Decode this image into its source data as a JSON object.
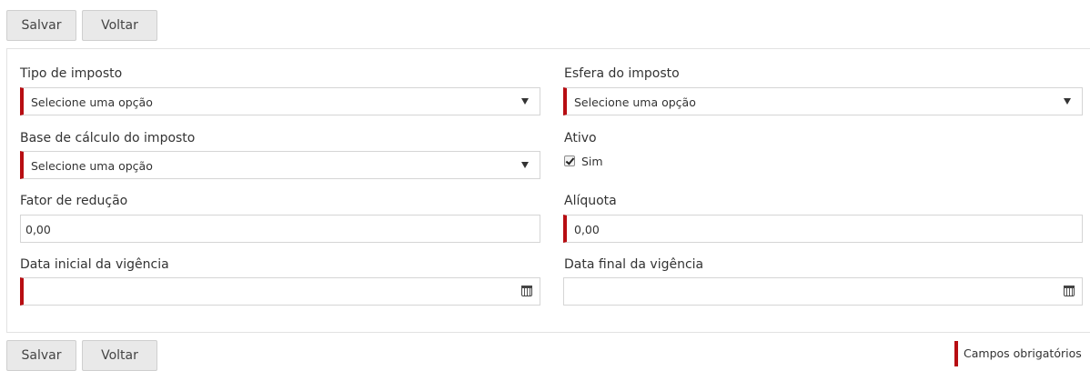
{
  "toolbar": {
    "save_label": "Salvar",
    "back_label": "Voltar"
  },
  "form": {
    "tipo_imposto": {
      "label": "Tipo de imposto",
      "value": "Selecione uma opção"
    },
    "esfera_imposto": {
      "label": "Esfera do imposto",
      "value": "Selecione uma opção"
    },
    "base_calculo": {
      "label": "Base de cálculo do imposto",
      "value": "Selecione uma opção"
    },
    "ativo": {
      "label": "Ativo",
      "option_label": "Sim",
      "checked": true
    },
    "fator_reducao": {
      "label": "Fator de redução",
      "value": "0,00"
    },
    "aliquota": {
      "label": "Alíquota",
      "value": "0,00"
    },
    "data_inicial": {
      "label": "Data inicial da vigência",
      "value": ""
    },
    "data_final": {
      "label": "Data final da vigência",
      "value": ""
    }
  },
  "legend": {
    "required_label": "Campos obrigatórios"
  },
  "colors": {
    "required_marker": "#b70d12",
    "button_bg": "#e9e9e9"
  },
  "icons": {
    "select_caret": "caret-down-icon",
    "date_picker": "calendar-icon"
  }
}
